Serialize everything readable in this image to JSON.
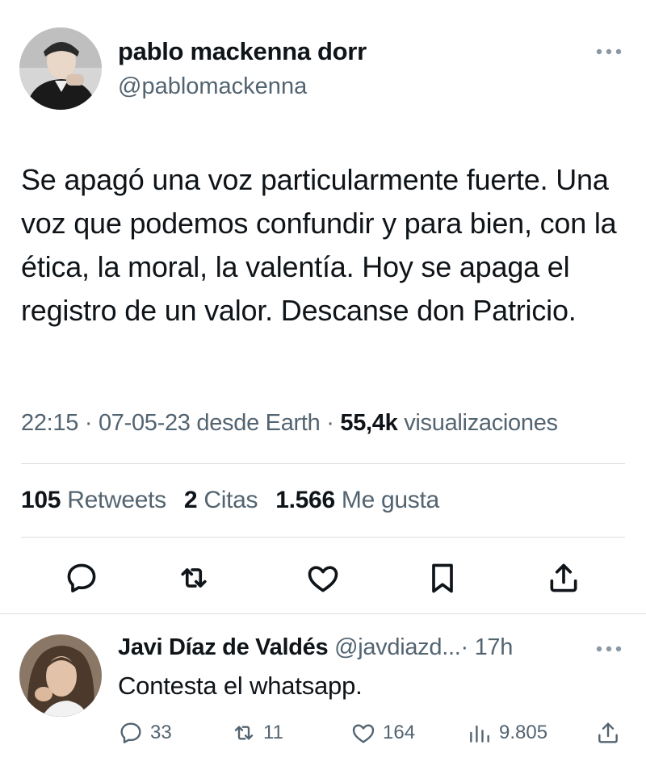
{
  "tweet": {
    "author_name": "pablo mackenna dorr",
    "author_handle": "@pablomackenna",
    "text": "Se apagó una voz particularmente fuerte. Una voz que podemos confundir y para bien, con la ética, la moral, la valentía. Hoy se apaga el registro de un valor. Descanse don Patricio.",
    "timestamp": "22:15 · 07-05-23 desde Earth ·",
    "views_count": "55,4k",
    "views_label": "visualizaciones",
    "stats": {
      "retweets_count": "105",
      "retweets_label": "Retweets",
      "quotes_count": "2",
      "quotes_label": "Citas",
      "likes_count": "1.566",
      "likes_label": "Me gusta"
    },
    "actions": [
      "reply-icon",
      "retweet-icon",
      "like-icon",
      "bookmark-icon",
      "share-icon"
    ]
  },
  "reply": {
    "author_name": "Javi Díaz de Valdés",
    "author_handle": "@javdiazd...",
    "time": "· 17h",
    "text": "Contesta el whatsapp.",
    "replies_count": "33",
    "retweets_count": "11",
    "likes_count": "164",
    "views_count": "9.805"
  },
  "colors": {
    "text_primary": "#0f1419",
    "text_secondary": "#536471",
    "divider": "#d9dde0",
    "more_dots": "#8b98a5"
  }
}
